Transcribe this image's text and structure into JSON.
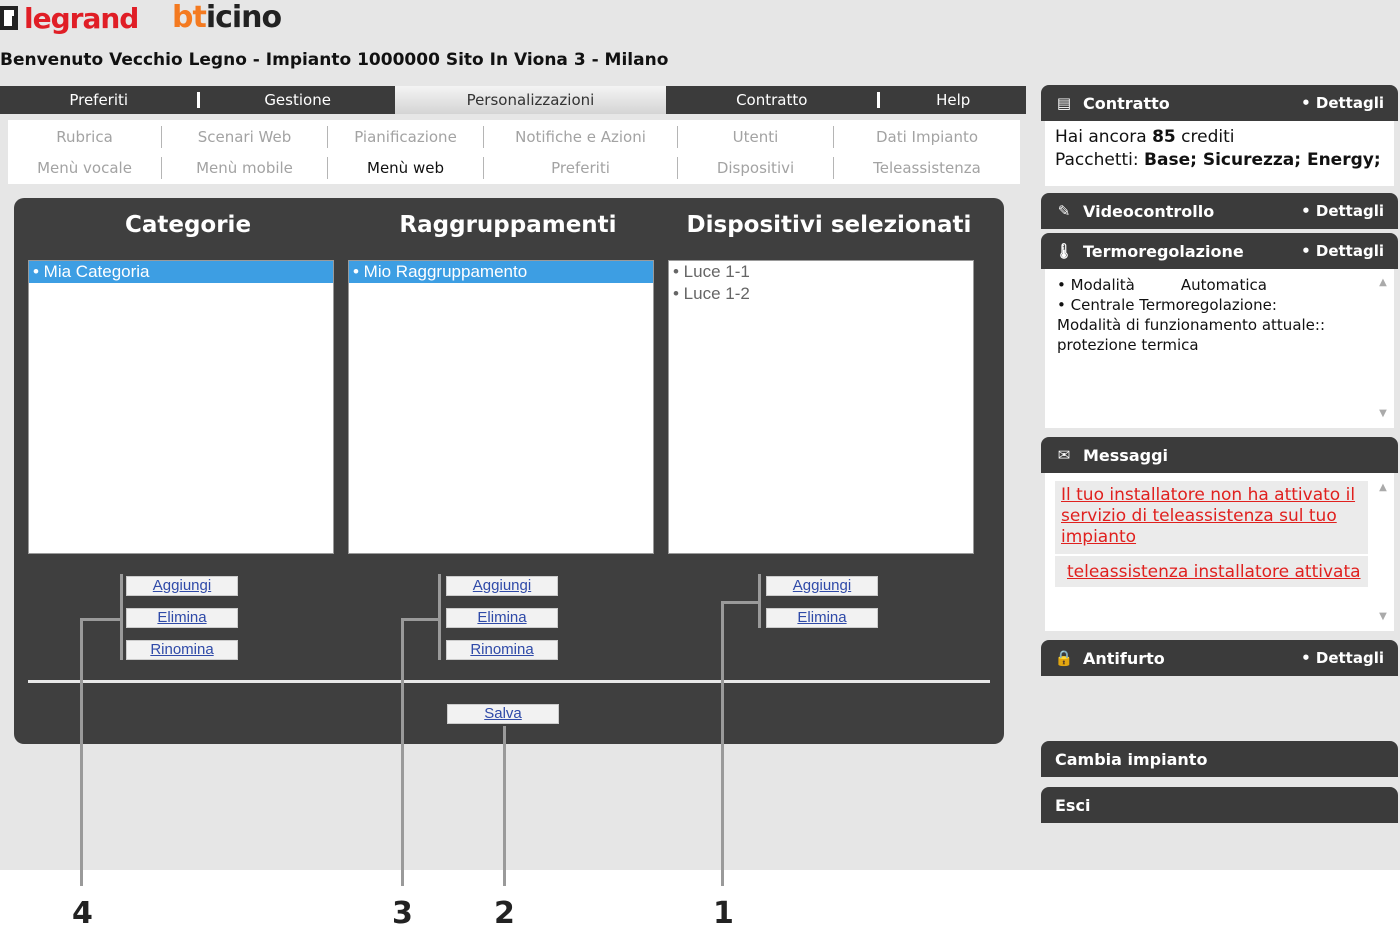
{
  "brand": {
    "legrand": "legrand",
    "bticino_b": "bt",
    "bticino_rest": "icino"
  },
  "welcome": "Benvenuto Vecchio Legno - Impianto 1000000 Sito In Viona 3 - Milano",
  "main_tabs": [
    {
      "label": "Preferiti"
    },
    {
      "label": "Gestione"
    },
    {
      "label": "Personalizzazioni",
      "active": true
    },
    {
      "label": "Contratto"
    },
    {
      "label": "Help"
    }
  ],
  "sub_nav": {
    "row1": [
      "Rubrica",
      "Scenari Web",
      "Pianificazione",
      "Notifiche e Azioni",
      "Utenti",
      "Dati Impianto"
    ],
    "row2": [
      "Menù vocale",
      "Menù mobile",
      "Menù web",
      "Preferiti",
      "Dispositivi",
      "Teleassistenza"
    ],
    "active": "Menù web"
  },
  "columns": {
    "categorie": {
      "title": "Categorie",
      "items": [
        "• Mia Categoria"
      ],
      "buttons": {
        "add": "Aggiungi",
        "delete": "Elimina",
        "rename": "Rinomina"
      }
    },
    "raggruppamenti": {
      "title": "Raggruppamenti",
      "items": [
        "• Mio Raggruppamento"
      ],
      "buttons": {
        "add": "Aggiungi",
        "delete": "Elimina",
        "rename": "Rinomina"
      }
    },
    "dispositivi": {
      "title": "Dispositivi selezionati",
      "items": [
        "• Luce 1-1",
        "• Luce 1-2"
      ],
      "buttons": {
        "add": "Aggiungi",
        "delete": "Elimina"
      }
    }
  },
  "save_label": "Salva",
  "callouts": [
    "4",
    "3",
    "2",
    "1"
  ],
  "sidebar": {
    "contratto": {
      "title": "Contratto",
      "details": "• Dettagli",
      "credits_prefix": "Hai ancora ",
      "credits_value": "85",
      "credits_suffix": " crediti",
      "packages_prefix": "Pacchetti: ",
      "packages": "Base; Sicurezza; Energy;"
    },
    "videocontrollo": {
      "title": "Videocontrollo",
      "details": "• Dettagli"
    },
    "termoregolazione": {
      "title": "Termoregolazione",
      "details": "• Dettagli",
      "mode_label": "• Modalità",
      "mode_value": "Automatica",
      "central_label": "• Centrale Termoregolazione:",
      "current_mode_label": "Modalità di funzionamento attuale::",
      "current_mode_value": "protezione termica"
    },
    "messaggi": {
      "title": "Messaggi",
      "msg1": "Il tuo installatore non ha attivato il servizio di teleassistenza sul tuo impianto",
      "msg2": "teleassistenza installatore attivata"
    },
    "antifurto": {
      "title": "Antifurto",
      "details": "• Dettagli"
    },
    "cambia_impianto": "Cambia impianto",
    "esci": "Esci"
  },
  "colors": {
    "dark_panel": "#3f3f3f",
    "selection": "#3d9ee3",
    "link_blue": "#2f4aa8",
    "message_red": "#e0201e",
    "legrand_red": "#e01e26",
    "bticino_orange": "#f47a20"
  },
  "icons": [
    "contract-icon",
    "camera-icon",
    "thermometer-icon",
    "envelope-icon",
    "lock-icon"
  ]
}
